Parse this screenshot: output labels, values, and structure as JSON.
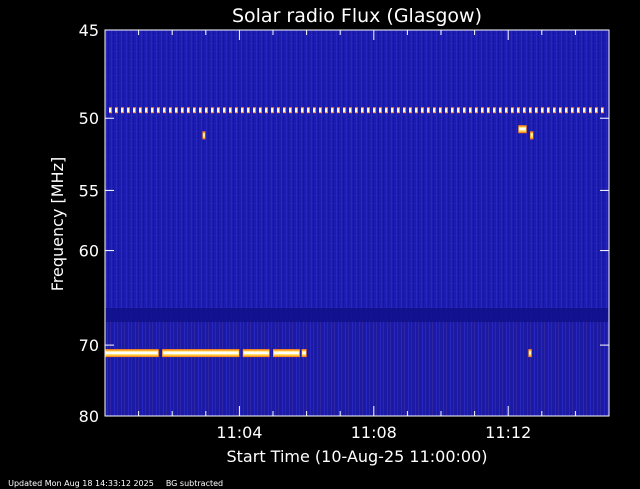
{
  "chart_data": {
    "type": "heatmap",
    "title": "Solar radio Flux (Glasgow)",
    "xlabel": "Start Time (10-Aug-25 11:00:00)",
    "ylabel": "Frequency [MHz]",
    "x_unit": "minutes after 11:00:00",
    "xlim": [
      0,
      15
    ],
    "x_ticks": [
      {
        "value": 4,
        "label": "11:04"
      },
      {
        "value": 8,
        "label": "11:08"
      },
      {
        "value": 12,
        "label": "11:12"
      }
    ],
    "y_scale": "reciprocal (inverted, 45 at top, 80 at bottom)",
    "ylim": [
      45,
      80
    ],
    "y_ticks": [
      {
        "value": 45,
        "label": "45"
      },
      {
        "value": 50,
        "label": "50"
      },
      {
        "value": 55,
        "label": "55"
      },
      {
        "value": 60,
        "label": "60"
      },
      {
        "value": 70,
        "label": "70"
      },
      {
        "value": 80,
        "label": "80"
      }
    ],
    "grid": false,
    "background_level": "low (blue), with faint vertical streaks",
    "features": [
      {
        "kind": "dashed emission line",
        "frequency_mhz": 49.5,
        "x_start": 0,
        "x_end": 15,
        "intensity": "high"
      },
      {
        "kind": "emission segment",
        "frequency_mhz": 71,
        "x_start": 0.0,
        "x_end": 1.6,
        "intensity": "high"
      },
      {
        "kind": "emission segment",
        "frequency_mhz": 71,
        "x_start": 1.7,
        "x_end": 4.0,
        "intensity": "high"
      },
      {
        "kind": "emission segment",
        "frequency_mhz": 71,
        "x_start": 4.1,
        "x_end": 4.9,
        "intensity": "high"
      },
      {
        "kind": "emission segment",
        "frequency_mhz": 71,
        "x_start": 5.0,
        "x_end": 5.8,
        "intensity": "high"
      },
      {
        "kind": "emission segment",
        "frequency_mhz": 71,
        "x_start": 5.85,
        "x_end": 6.0,
        "intensity": "high"
      },
      {
        "kind": "emission spot",
        "frequency_mhz": 71,
        "x_start": 12.6,
        "x_end": 12.7,
        "intensity": "high"
      },
      {
        "kind": "emission spot",
        "frequency_mhz": 51.1,
        "x_start": 2.9,
        "x_end": 2.95,
        "intensity": "high"
      },
      {
        "kind": "emission spot",
        "frequency_mhz": 50.7,
        "x_start": 12.3,
        "x_end": 12.55,
        "intensity": "high"
      },
      {
        "kind": "emission spot",
        "frequency_mhz": 51.1,
        "x_start": 12.65,
        "x_end": 12.75,
        "intensity": "high"
      }
    ]
  },
  "footer": {
    "updated": "Updated Mon Aug 18 14:33:12 2025",
    "note": "BG subtracted"
  },
  "colors": {
    "background": "#000000",
    "plot_base": "#1c1cae",
    "plot_dark": "#0e0e80",
    "streak": "#3a3ae0",
    "emission_core": "#ffffff",
    "emission_edge": "#ff8a1c",
    "emission_hot": "#ffe060",
    "axis": "#ffffff"
  }
}
